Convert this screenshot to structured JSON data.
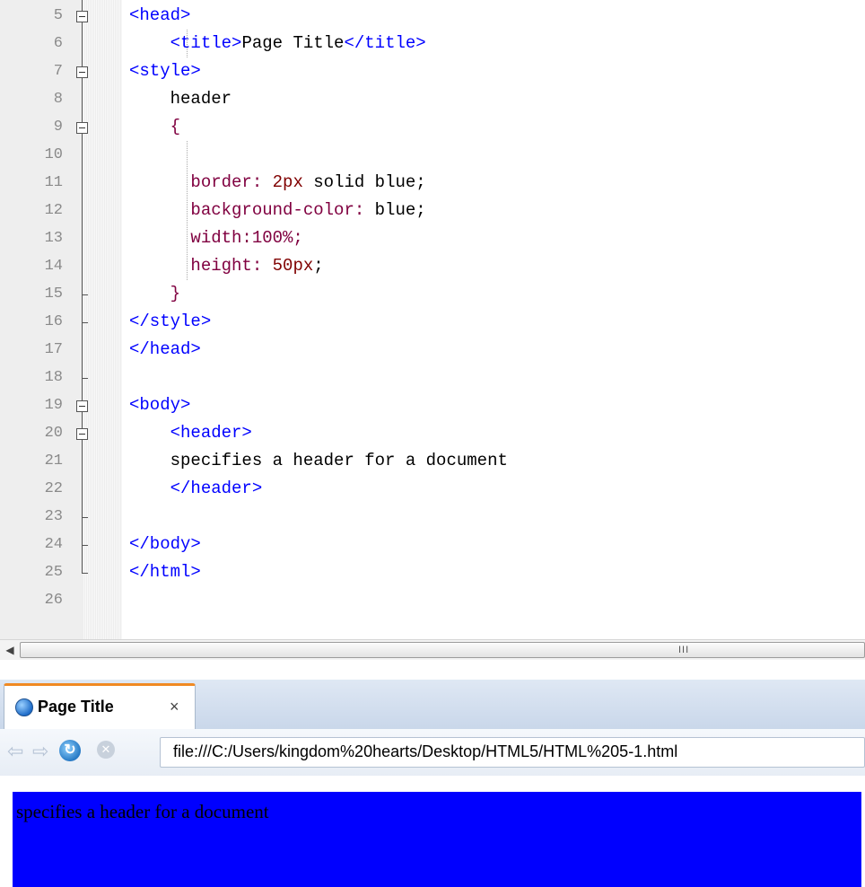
{
  "editor": {
    "lines": [
      {
        "num": "5",
        "segments": [
          {
            "t": "<head>",
            "c": "tag"
          }
        ]
      },
      {
        "num": "6",
        "segments": [
          {
            "t": "    ",
            "c": "plain"
          },
          {
            "t": "<title>",
            "c": "tag"
          },
          {
            "t": "Page Title",
            "c": "plain"
          },
          {
            "t": "</title>",
            "c": "tag"
          }
        ]
      },
      {
        "num": "7",
        "segments": [
          {
            "t": "<style>",
            "c": "tag"
          }
        ]
      },
      {
        "num": "8",
        "segments": [
          {
            "t": "    header",
            "c": "plain"
          }
        ]
      },
      {
        "num": "9",
        "segments": [
          {
            "t": "    {",
            "c": "brace"
          }
        ]
      },
      {
        "num": "10",
        "segments": []
      },
      {
        "num": "11",
        "segments": [
          {
            "t": "      border: ",
            "c": "prop"
          },
          {
            "t": "2px",
            "c": "val"
          },
          {
            "t": " solid blue;",
            "c": "plain"
          }
        ]
      },
      {
        "num": "12",
        "segments": [
          {
            "t": "      background-color: ",
            "c": "prop"
          },
          {
            "t": "blue;",
            "c": "plain"
          }
        ]
      },
      {
        "num": "13",
        "segments": [
          {
            "t": "      width:100%;",
            "c": "prop"
          }
        ]
      },
      {
        "num": "14",
        "segments": [
          {
            "t": "      height: ",
            "c": "prop"
          },
          {
            "t": "50px",
            "c": "val"
          },
          {
            "t": ";",
            "c": "plain"
          }
        ]
      },
      {
        "num": "15",
        "segments": [
          {
            "t": "    }",
            "c": "brace"
          }
        ]
      },
      {
        "num": "16",
        "segments": [
          {
            "t": "</style>",
            "c": "tag"
          }
        ]
      },
      {
        "num": "17",
        "segments": [
          {
            "t": "</head>",
            "c": "tag"
          }
        ]
      },
      {
        "num": "18",
        "segments": []
      },
      {
        "num": "19",
        "segments": [
          {
            "t": "<body>",
            "c": "tag"
          }
        ]
      },
      {
        "num": "20",
        "segments": [
          {
            "t": "    <header>",
            "c": "tag"
          }
        ]
      },
      {
        "num": "21",
        "segments": [
          {
            "t": "    specifies a header for a document",
            "c": "plain"
          }
        ]
      },
      {
        "num": "22",
        "segments": [
          {
            "t": "    </header>",
            "c": "tag"
          }
        ]
      },
      {
        "num": "23",
        "segments": []
      },
      {
        "num": "24",
        "segments": [
          {
            "t": "</body>",
            "c": "tag"
          }
        ]
      },
      {
        "num": "25",
        "segments": [
          {
            "t": "</html>",
            "c": "tag"
          }
        ]
      },
      {
        "num": "26",
        "segments": []
      }
    ],
    "scrollbar_grip": "III"
  },
  "browser": {
    "tab_title": "Page Title",
    "tab_close": "×",
    "url": "file:///C:/Users/kingdom%20hearts/Desktop/HTML5/HTML%205-1.html",
    "rendered_header_text": "specifies a header for a document",
    "colors": {
      "header_bg": "#0000ff",
      "tab_accent": "#f08a24"
    }
  }
}
